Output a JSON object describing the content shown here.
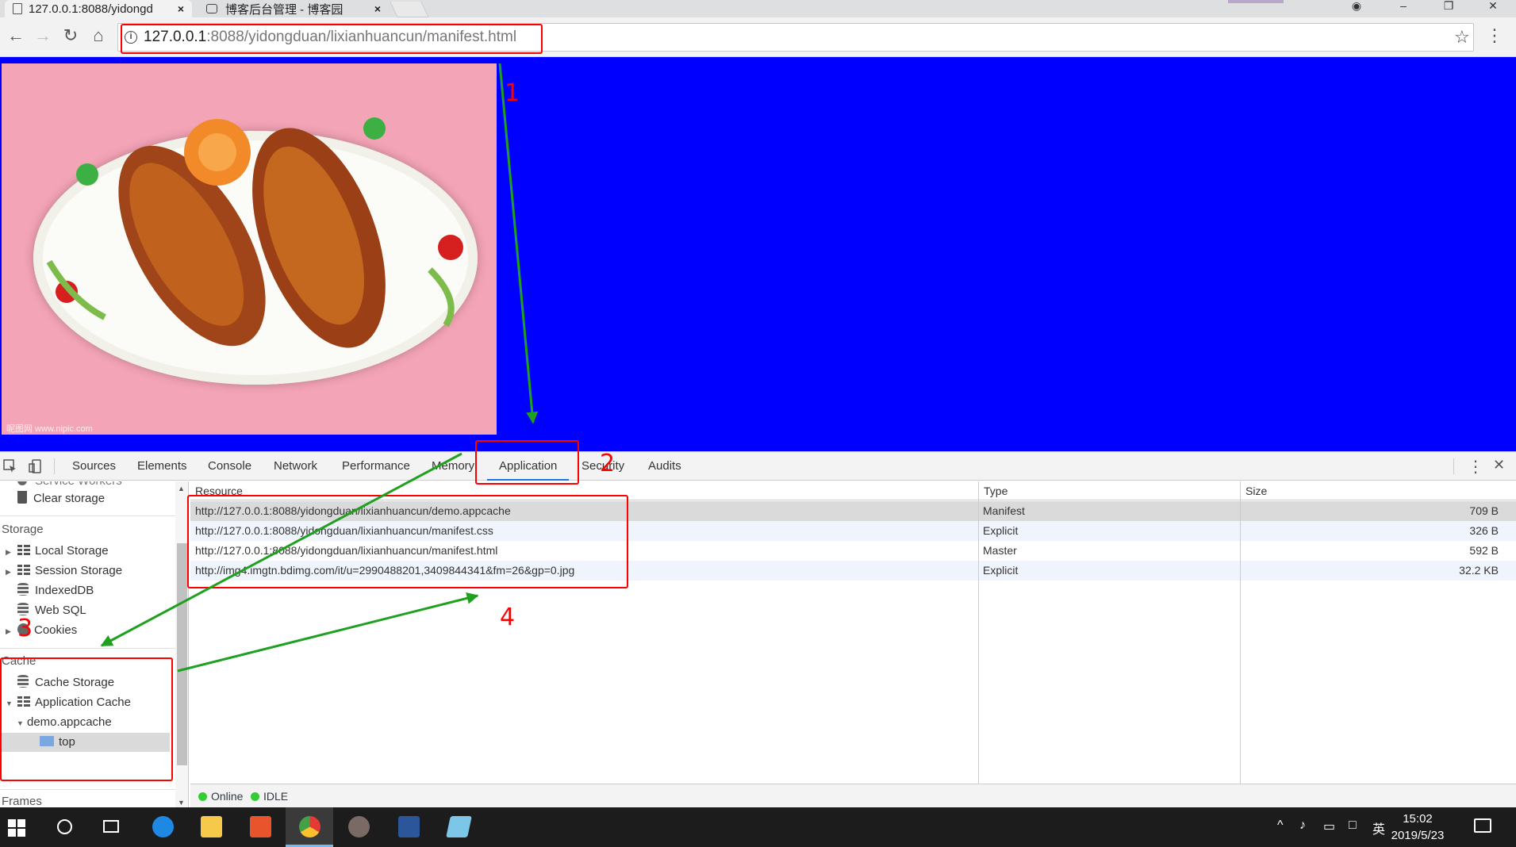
{
  "browser": {
    "tabs": [
      {
        "title": "127.0.0.1:8088/yidongduan/lixianhuancun/manifest.html",
        "display": "127.0.0.1:8088/yidongd",
        "close": "×"
      },
      {
        "title": "博客后台管理 - 博客园",
        "close": "×"
      }
    ],
    "address": {
      "host": "127.0.0.1",
      "rest": ":8088/yidongduan/lixianhuancun/manifest.html"
    },
    "nav": {
      "back": "←",
      "forward": "→",
      "reload": "↻",
      "home": "⌂",
      "star": "☆",
      "menu": "⋮"
    },
    "window": {
      "account": "◉",
      "minimize": "–",
      "maximize": "❐",
      "close": "✕"
    }
  },
  "devtools": {
    "tabs": [
      "Sources",
      "Elements",
      "Console",
      "Network",
      "Performance",
      "Memory",
      "Application",
      "Security",
      "Audits"
    ],
    "active_tab": "Application",
    "sidebar": {
      "top_item_partial": "Service Workers",
      "clear_storage": "Clear storage",
      "storage_header": "Storage",
      "storage_items": [
        "Local Storage",
        "Session Storage",
        "IndexedDB",
        "Web SQL",
        "Cookies"
      ],
      "cache_header": "Cache",
      "cache_items": [
        "Cache Storage",
        "Application Cache"
      ],
      "appcache_child": "demo.appcache",
      "appcache_grandchild": "top",
      "frames_header": "Frames"
    },
    "table": {
      "columns": [
        "Resource",
        "Type",
        "Size"
      ],
      "rows": [
        {
          "resource": "http://127.0.0.1:8088/yidongduan/lixianhuancun/demo.appcache",
          "type": "Manifest",
          "size": "709 B"
        },
        {
          "resource": "http://127.0.0.1:8088/yidongduan/lixianhuancun/manifest.css",
          "type": "Explicit",
          "size": "326 B"
        },
        {
          "resource": "http://127.0.0.1:8088/yidongduan/lixianhuancun/manifest.html",
          "type": "Master",
          "size": "592 B"
        },
        {
          "resource": "http://img4.imgtn.bdimg.com/it/u=2990488201,3409844341&fm=26&gp=0.jpg",
          "type": "Explicit",
          "size": "32.2 KB"
        }
      ]
    },
    "status": {
      "online": "Online",
      "idle": "IDLE"
    }
  },
  "annotations": {
    "labels": [
      "1",
      "2",
      "3",
      "4"
    ],
    "color": "#ff0000",
    "arrow_color": "#1fa01f"
  },
  "page": {
    "background": "#0000ff",
    "image_watermark": "昵图网 www.nipic.com"
  },
  "taskbar": {
    "time": "15:02",
    "date": "2019/5/23",
    "ime": "英"
  }
}
